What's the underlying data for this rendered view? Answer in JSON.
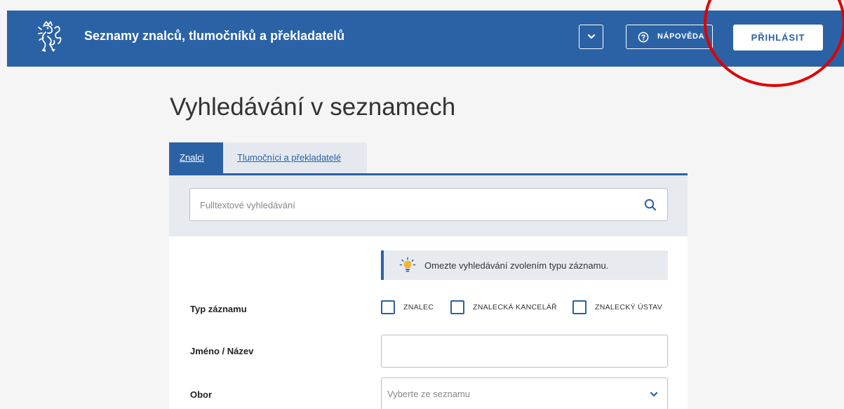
{
  "header": {
    "site_title": "Seznamy znalců, tlumočníků a překladatelů",
    "help_label": "NÁPOVĚDA",
    "login_label": "PŘIHLÁSIT"
  },
  "page": {
    "title": "Vyhledávání v seznamech"
  },
  "tabs": [
    {
      "label": "Znalci",
      "active": true
    },
    {
      "label": "Tlumočníci a překladatelé",
      "active": false
    }
  ],
  "search": {
    "placeholder": "Fulltextové vyhledávání",
    "value": ""
  },
  "hint": {
    "text": "Omezte vyhledávání zvolením typu záznamu."
  },
  "form": {
    "record_type": {
      "label": "Typ záznamu",
      "options": [
        {
          "label": "ZNALEC",
          "checked": false
        },
        {
          "label": "ZNALECKÁ KANCELÁŘ",
          "checked": false
        },
        {
          "label": "ZNALECKÝ ÚSTAV",
          "checked": false
        }
      ]
    },
    "name": {
      "label": "Jméno / Název",
      "value": ""
    },
    "field": {
      "label": "Obor",
      "placeholder": "Vyberte ze seznamu"
    }
  },
  "colors": {
    "brand_blue": "#2a62a5",
    "light_panel": "#e7ebf0",
    "annotation_red": "#e00000"
  },
  "icons": {
    "logo": "czech-lion-icon",
    "dropdown": "chevron-down-icon",
    "help": "question-circle-icon",
    "search": "search-icon",
    "hint": "lightbulb-icon"
  }
}
